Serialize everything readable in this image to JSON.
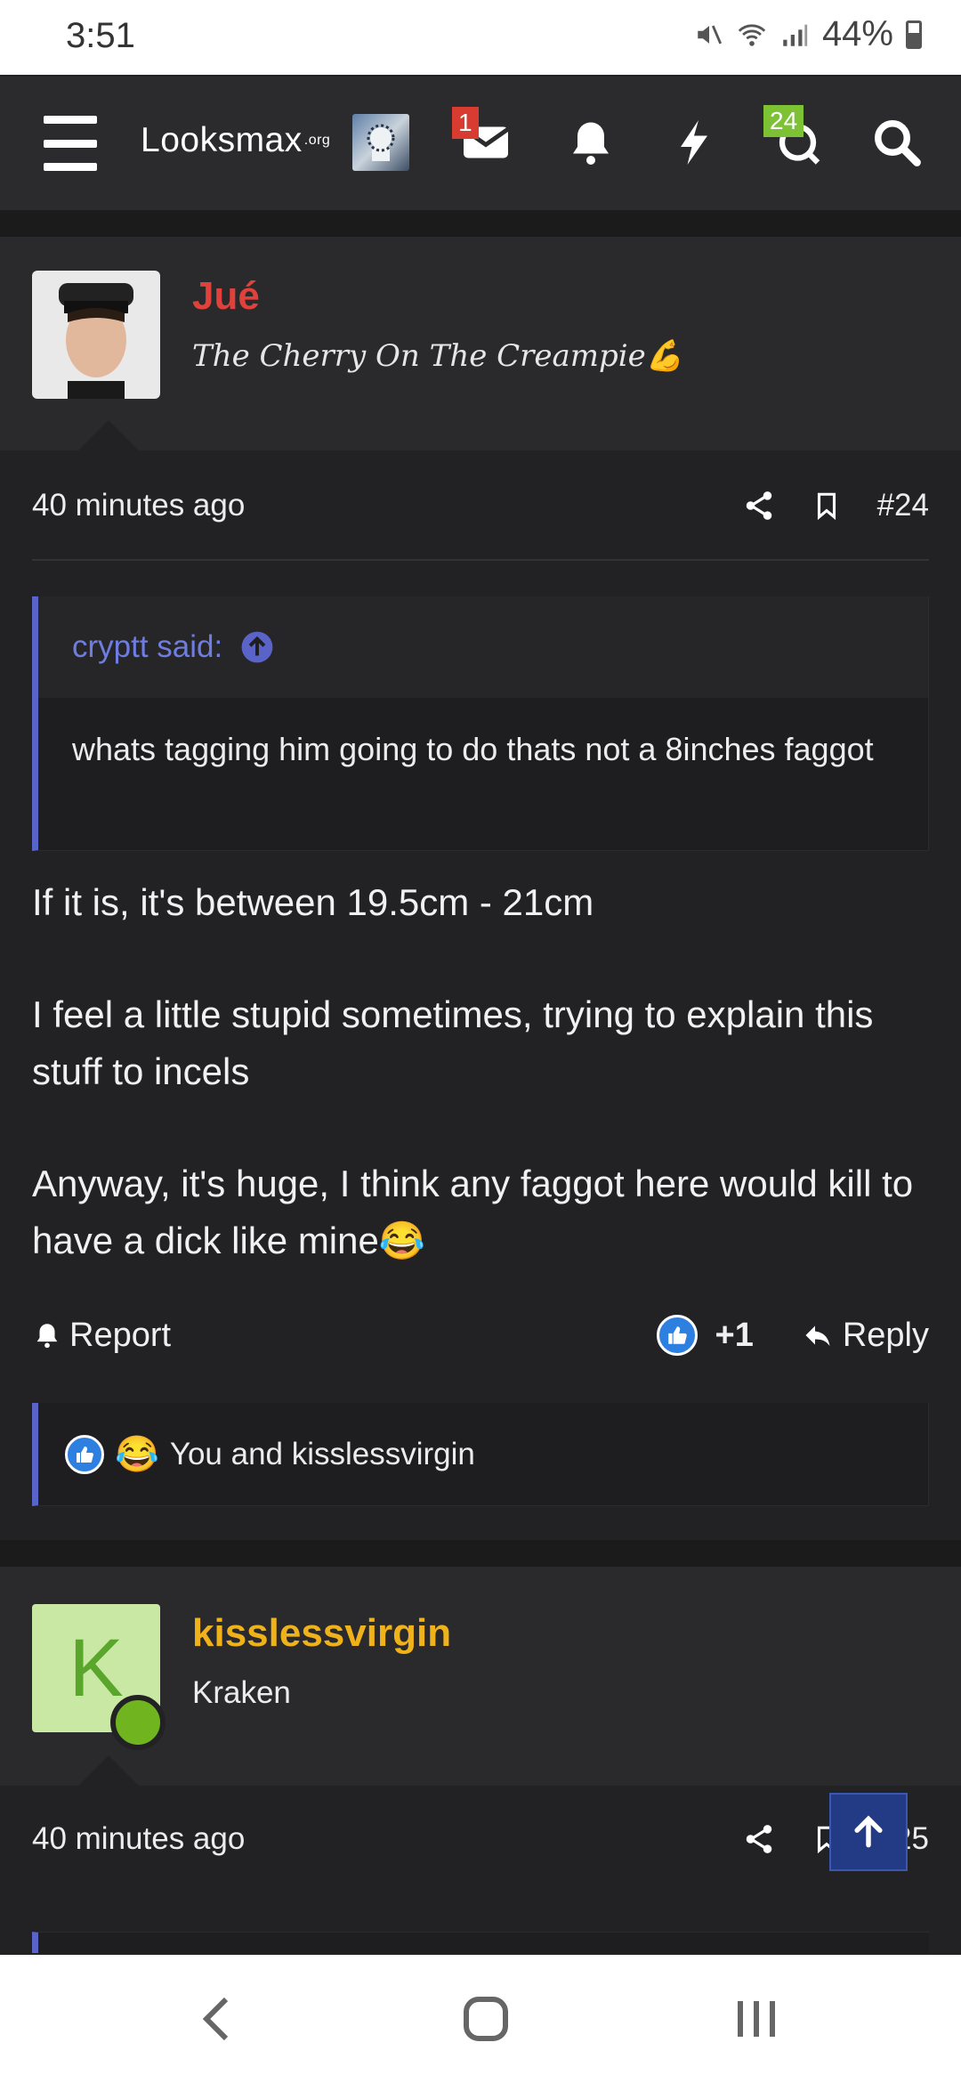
{
  "status_bar": {
    "time": "3:51",
    "battery": "44%"
  },
  "nav": {
    "logo": "Looksmax",
    "logo_suffix": ".org",
    "inbox_badge": "1",
    "chat_badge": "24",
    "icons": [
      "menu-icon",
      "avatar",
      "inbox-icon",
      "bell-icon",
      "bolt-icon",
      "chat-icon",
      "search-icon"
    ]
  },
  "post1": {
    "username": "Jué",
    "username_color": "#e0413a",
    "user_title": "The Cherry On The Creampie💪",
    "time": "40 minutes ago",
    "number": "#24",
    "quote_author": "cryptt said:",
    "quote_text": "whats tagging him going to do thats not a 8inches faggot",
    "message_p1": "If it is, it's between 19.5cm - 21cm",
    "message_p2": "I feel a little stupid sometimes, trying to explain this stuff to incels",
    "message_p3": "Anyway, it's huge, I think any faggot here would kill to have a dick like mine😂",
    "report_label": "Report",
    "like_count": "+1",
    "reply_label": "Reply",
    "reactions_text": "You and kisslessvirgin"
  },
  "post2": {
    "avatar_letter": "K",
    "username": "kisslessvirgin",
    "username_color": "#f0b21b",
    "user_title": "Kraken",
    "time": "40 minutes ago",
    "number": "#25"
  },
  "colors": {
    "accent": "#5a63c8",
    "quote_link": "#6f7de0",
    "like_blue": "#2d7fe0"
  }
}
